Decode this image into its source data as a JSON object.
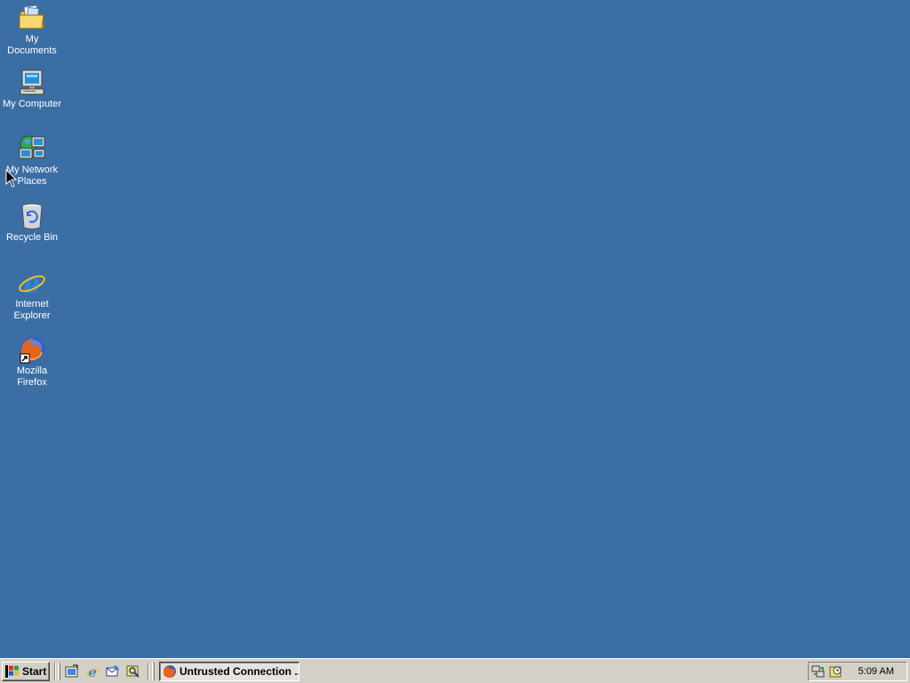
{
  "desktop": {
    "background_color": "#3a6ea5",
    "icons": [
      {
        "label": "My Documents",
        "icon": "folder-documents-icon"
      },
      {
        "label": "My Computer",
        "icon": "computer-icon"
      },
      {
        "label": "My Network\nPlaces",
        "icon": "network-places-icon"
      },
      {
        "label": "Recycle Bin",
        "icon": "recycle-bin-icon"
      },
      {
        "label": "Internet\nExplorer",
        "icon": "internet-explorer-icon"
      },
      {
        "label": "Mozilla Firefox",
        "icon": "firefox-shortcut-icon"
      }
    ]
  },
  "taskbar": {
    "start_label": "Start",
    "quick_launch": [
      {
        "icon": "show-desktop-icon"
      },
      {
        "icon": "internet-explorer-icon"
      },
      {
        "icon": "outlook-express-icon"
      },
      {
        "icon": "windows-media-icon"
      }
    ],
    "tasks": [
      {
        "label": "Untrusted Connection ...",
        "icon": "firefox-icon",
        "active": true
      }
    ],
    "tray": {
      "icons": [
        "network-tray-icon",
        "scheduler-tray-icon"
      ],
      "clock": "5:09 AM"
    }
  }
}
